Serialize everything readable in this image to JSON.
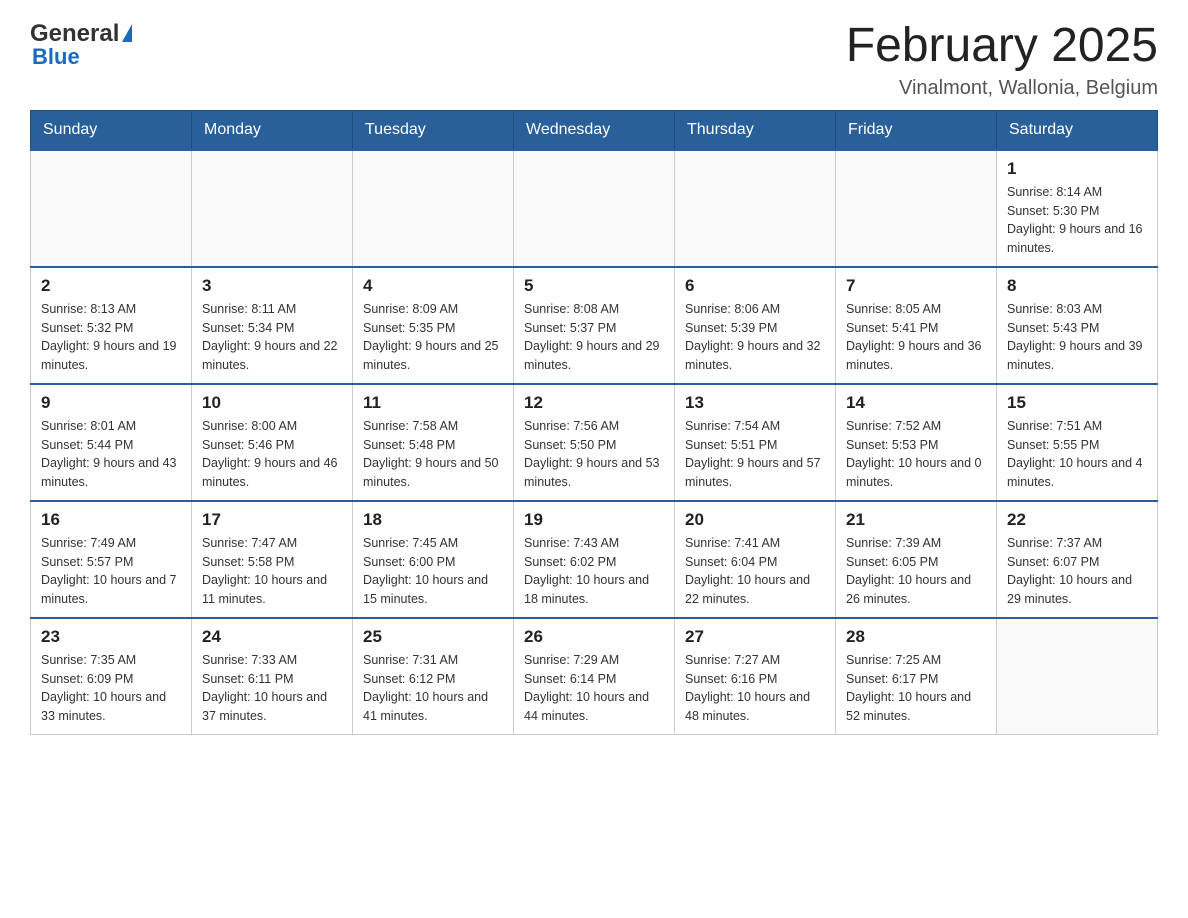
{
  "header": {
    "logo_general": "General",
    "logo_blue": "Blue",
    "month_title": "February 2025",
    "location": "Vinalmont, Wallonia, Belgium"
  },
  "days_of_week": [
    "Sunday",
    "Monday",
    "Tuesday",
    "Wednesday",
    "Thursday",
    "Friday",
    "Saturday"
  ],
  "weeks": [
    {
      "days": [
        {
          "number": "",
          "info": ""
        },
        {
          "number": "",
          "info": ""
        },
        {
          "number": "",
          "info": ""
        },
        {
          "number": "",
          "info": ""
        },
        {
          "number": "",
          "info": ""
        },
        {
          "number": "",
          "info": ""
        },
        {
          "number": "1",
          "info": "Sunrise: 8:14 AM\nSunset: 5:30 PM\nDaylight: 9 hours and 16 minutes."
        }
      ]
    },
    {
      "days": [
        {
          "number": "2",
          "info": "Sunrise: 8:13 AM\nSunset: 5:32 PM\nDaylight: 9 hours and 19 minutes."
        },
        {
          "number": "3",
          "info": "Sunrise: 8:11 AM\nSunset: 5:34 PM\nDaylight: 9 hours and 22 minutes."
        },
        {
          "number": "4",
          "info": "Sunrise: 8:09 AM\nSunset: 5:35 PM\nDaylight: 9 hours and 25 minutes."
        },
        {
          "number": "5",
          "info": "Sunrise: 8:08 AM\nSunset: 5:37 PM\nDaylight: 9 hours and 29 minutes."
        },
        {
          "number": "6",
          "info": "Sunrise: 8:06 AM\nSunset: 5:39 PM\nDaylight: 9 hours and 32 minutes."
        },
        {
          "number": "7",
          "info": "Sunrise: 8:05 AM\nSunset: 5:41 PM\nDaylight: 9 hours and 36 minutes."
        },
        {
          "number": "8",
          "info": "Sunrise: 8:03 AM\nSunset: 5:43 PM\nDaylight: 9 hours and 39 minutes."
        }
      ]
    },
    {
      "days": [
        {
          "number": "9",
          "info": "Sunrise: 8:01 AM\nSunset: 5:44 PM\nDaylight: 9 hours and 43 minutes."
        },
        {
          "number": "10",
          "info": "Sunrise: 8:00 AM\nSunset: 5:46 PM\nDaylight: 9 hours and 46 minutes."
        },
        {
          "number": "11",
          "info": "Sunrise: 7:58 AM\nSunset: 5:48 PM\nDaylight: 9 hours and 50 minutes."
        },
        {
          "number": "12",
          "info": "Sunrise: 7:56 AM\nSunset: 5:50 PM\nDaylight: 9 hours and 53 minutes."
        },
        {
          "number": "13",
          "info": "Sunrise: 7:54 AM\nSunset: 5:51 PM\nDaylight: 9 hours and 57 minutes."
        },
        {
          "number": "14",
          "info": "Sunrise: 7:52 AM\nSunset: 5:53 PM\nDaylight: 10 hours and 0 minutes."
        },
        {
          "number": "15",
          "info": "Sunrise: 7:51 AM\nSunset: 5:55 PM\nDaylight: 10 hours and 4 minutes."
        }
      ]
    },
    {
      "days": [
        {
          "number": "16",
          "info": "Sunrise: 7:49 AM\nSunset: 5:57 PM\nDaylight: 10 hours and 7 minutes."
        },
        {
          "number": "17",
          "info": "Sunrise: 7:47 AM\nSunset: 5:58 PM\nDaylight: 10 hours and 11 minutes."
        },
        {
          "number": "18",
          "info": "Sunrise: 7:45 AM\nSunset: 6:00 PM\nDaylight: 10 hours and 15 minutes."
        },
        {
          "number": "19",
          "info": "Sunrise: 7:43 AM\nSunset: 6:02 PM\nDaylight: 10 hours and 18 minutes."
        },
        {
          "number": "20",
          "info": "Sunrise: 7:41 AM\nSunset: 6:04 PM\nDaylight: 10 hours and 22 minutes."
        },
        {
          "number": "21",
          "info": "Sunrise: 7:39 AM\nSunset: 6:05 PM\nDaylight: 10 hours and 26 minutes."
        },
        {
          "number": "22",
          "info": "Sunrise: 7:37 AM\nSunset: 6:07 PM\nDaylight: 10 hours and 29 minutes."
        }
      ]
    },
    {
      "days": [
        {
          "number": "23",
          "info": "Sunrise: 7:35 AM\nSunset: 6:09 PM\nDaylight: 10 hours and 33 minutes."
        },
        {
          "number": "24",
          "info": "Sunrise: 7:33 AM\nSunset: 6:11 PM\nDaylight: 10 hours and 37 minutes."
        },
        {
          "number": "25",
          "info": "Sunrise: 7:31 AM\nSunset: 6:12 PM\nDaylight: 10 hours and 41 minutes."
        },
        {
          "number": "26",
          "info": "Sunrise: 7:29 AM\nSunset: 6:14 PM\nDaylight: 10 hours and 44 minutes."
        },
        {
          "number": "27",
          "info": "Sunrise: 7:27 AM\nSunset: 6:16 PM\nDaylight: 10 hours and 48 minutes."
        },
        {
          "number": "28",
          "info": "Sunrise: 7:25 AM\nSunset: 6:17 PM\nDaylight: 10 hours and 52 minutes."
        },
        {
          "number": "",
          "info": ""
        }
      ]
    }
  ]
}
